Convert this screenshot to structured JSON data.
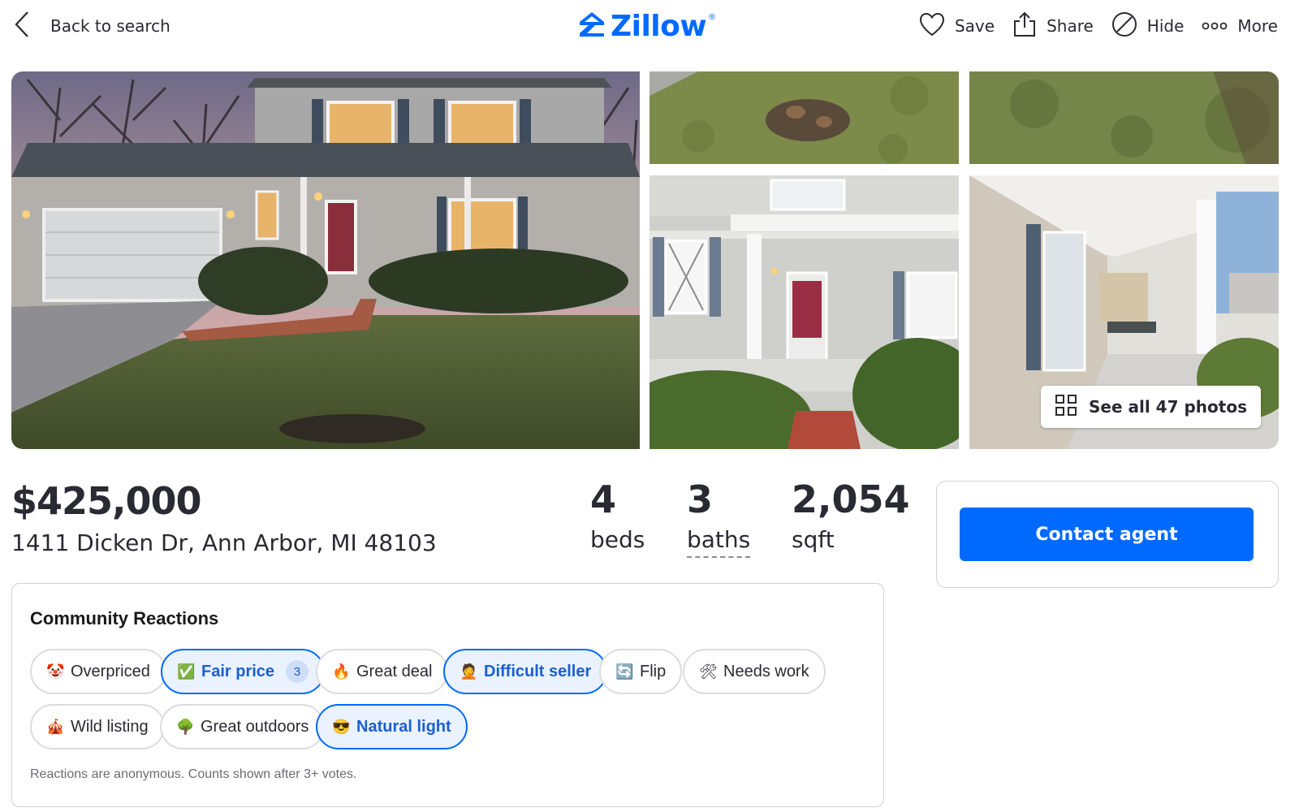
{
  "header": {
    "back_label": "Back to search",
    "logo_text": "Zillow",
    "logo_sup": "®",
    "actions": [
      {
        "label": "Save",
        "icon": "heart-icon"
      },
      {
        "label": "Share",
        "icon": "share-icon"
      },
      {
        "label": "Hide",
        "icon": "hide-icon"
      },
      {
        "label": "More",
        "icon": "more-icon"
      }
    ]
  },
  "gallery": {
    "see_all_label": "See all 47 photos",
    "photos": [
      "house-exterior-dusk",
      "front-lawn-flowerbed",
      "side-lawn",
      "front-porch-door",
      "covered-porch"
    ]
  },
  "listing": {
    "price": "$425,000",
    "address": "1411 Dicken Dr, Ann Arbor, MI 48103",
    "facts": [
      {
        "value": "4",
        "label": "beds"
      },
      {
        "value": "3",
        "label": "baths"
      },
      {
        "value": "2,054",
        "label": "sqft"
      }
    ]
  },
  "contact": {
    "button_label": "Contact agent"
  },
  "reactions": {
    "title": "Community Reactions",
    "chips": [
      {
        "emoji": "🤡",
        "label": "Overpriced",
        "selected": false
      },
      {
        "emoji": "✅",
        "label": "Fair price",
        "selected": true,
        "count": "3"
      },
      {
        "emoji": "🔥",
        "label": "Great deal",
        "selected": false
      },
      {
        "emoji": "🤦",
        "label": "Difficult seller",
        "selected": true
      },
      {
        "emoji": "🔄",
        "label": "Flip",
        "selected": false
      },
      {
        "emoji": "🛠",
        "label": "Needs work",
        "selected": false
      },
      {
        "emoji": "🎪",
        "label": "Wild listing",
        "selected": false
      },
      {
        "emoji": "🌳",
        "label": "Great outdoors",
        "selected": false
      },
      {
        "emoji": "😎",
        "label": "Natural light",
        "selected": true
      }
    ],
    "note": "Reactions are anonymous. Counts shown after 3+ votes."
  },
  "colors": {
    "brand_blue": "#006aff",
    "selected_chip_bg": "#eaf2ff",
    "text": "#2a2a33"
  }
}
